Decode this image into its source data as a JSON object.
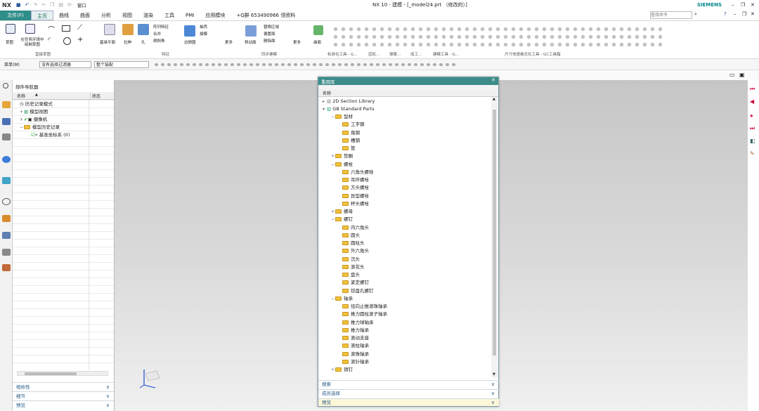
{
  "title": {
    "app": "NX",
    "window": "NX 10 - 建模 - [_model24.prt （修改的）]",
    "brand": "SIEMENS",
    "window_menu": "窗口"
  },
  "search": {
    "placeholder": "查找命令"
  },
  "menu": {
    "file": "文件(F)",
    "tabs": [
      "主页",
      "曲线",
      "曲面",
      "分析",
      "视图",
      "渲染",
      "工具",
      "PMI",
      "应用模块"
    ],
    "qq": "+Q群 653490966 领资料"
  },
  "ribbon": {
    "sketch": "草图",
    "sketch_task": "在任务环境中绘制草图",
    "direct_sketch_label": "直接草图",
    "datum_plane": "基准平面",
    "extrude": "拉伸",
    "hole": "孔",
    "pattern": "阵列特征",
    "combine": "合并",
    "chamfer": "倒斜角",
    "edge_blend": "边倒圆",
    "shell": "抽壳",
    "draft": "拔模",
    "more": "更多",
    "feature_label": "特征",
    "move_face": "移动面",
    "replace_face": "替换区域",
    "pull_face": "偏置面",
    "delete_face": "删除面",
    "sync_label": "同步建模",
    "surface": "曲面",
    "std_tools_label": "标准化工具 - G...",
    "gear_label": "齿轮...",
    "spring_label": "弹簧...",
    "machining_label": "加工...",
    "weld_label": "建模工具 - G...",
    "dim_label": "尺寸快速格式化工具 - GC工具箱"
  },
  "selbar": {
    "menu": "菜单(M)",
    "filter": "没有选择过滤器",
    "assembly": "整个装配"
  },
  "nav": {
    "title": "部件导航器",
    "col_name": "名称",
    "col_status": "状态",
    "items": [
      "历史记录模式",
      "模型视图",
      "摄像机",
      "模型历史记录",
      "基准坐标系 (0)"
    ],
    "dependencies": "相依性",
    "details": "细节",
    "preview": "预览"
  },
  "reuse": {
    "title": "重用库",
    "col_name": "名称",
    "root1": "2D Section Library",
    "root2": "GB Standard Parts",
    "nodes": [
      "型材",
      "工字钢",
      "角钢",
      "槽钢",
      "管",
      "垫圈",
      "螺栓",
      "六角头螺栓",
      "吊环螺栓",
      "方头螺栓",
      "异型螺栓",
      "杯头螺栓",
      "螺母",
      "螺钉",
      "内六角头",
      "圆头",
      "圆柱头",
      "外六角头",
      "沉头",
      "滚花头",
      "盘头",
      "紧定螺钉",
      "铰盘孔螺钉",
      "轴承",
      "径向止推滚珠轴承",
      "推力圆柱滚子轴承",
      "推力球轴承",
      "推力轴承",
      "滚动支座",
      "滚柱轴承",
      "滚珠轴承",
      "滚针轴承",
      "销钉"
    ],
    "search": "搜索",
    "member_select": "成员选择",
    "preview": "预览"
  }
}
